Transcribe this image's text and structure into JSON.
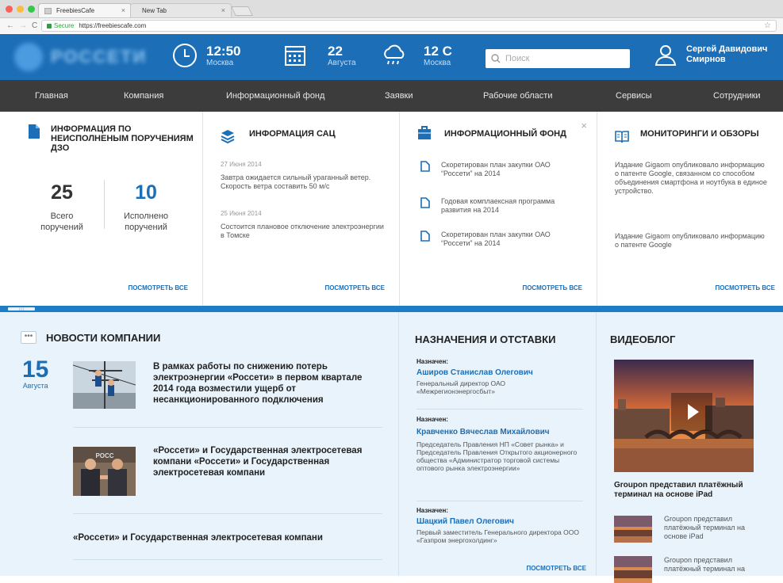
{
  "browser": {
    "tabs": [
      {
        "label": "FreebiesCafe"
      },
      {
        "label": "New Tab"
      }
    ],
    "secure_label": "Secure",
    "url": "https://freebiescafe.com"
  },
  "header": {
    "logo_text": "РОССЕТИ",
    "time": {
      "value": "12:50",
      "sub": "Москва"
    },
    "date": {
      "value": "22",
      "sub": "Августа"
    },
    "weather": {
      "value": "12 C",
      "sub": "Москва"
    },
    "search_placeholder": "Поиск",
    "user": {
      "first": "Сергей Давидович",
      "last": "Смирнов"
    }
  },
  "nav": [
    "Главная",
    "Компания",
    "Информационный фонд",
    "Заявки",
    "Рабочие области",
    "Сервисы",
    "Сотрудники"
  ],
  "widgets": {
    "orders": {
      "title": "Информация по неисполненым поручениям ДЗО",
      "total": "25",
      "total_label": "Всего поручений",
      "done": "10",
      "done_label": "Исполнено поручений",
      "more": "Посмотреть все"
    },
    "sac": {
      "title": "Информация САЦ",
      "items": [
        {
          "date": "27 Июня 2014",
          "text": "Завтра ожидается сильный ураганный ветер. Скорость ветра составить 50 м/с"
        },
        {
          "date": "25 Июня 2014",
          "text": "Состоится плановое отключение электроэнергии в Томске"
        }
      ],
      "more": "Посмотреть все"
    },
    "fund": {
      "title": "Информационный фонд",
      "items": [
        {
          "text": "Скоретирован план  закупки ОАО “Россети” на 2014"
        },
        {
          "text": "Годовая комплаексная программа развития на 2014"
        },
        {
          "text": "Скоретирован план  закупки ОАО “Россети” на 2014"
        }
      ],
      "more": "Посмотреть все"
    },
    "monitor": {
      "title": "Мониторинги и обзоры",
      "items": [
        {
          "text": "Издание Gigaom опубликовало информацию о патенте Google, связанном со способом объединения смартфона и ноутбука в единое устройство."
        },
        {
          "text": "Издание Gigaom опубликовало информацию о патенте Google"
        }
      ],
      "more": "Посмотреть все"
    }
  },
  "news": {
    "title": "Новости компании",
    "day": "15",
    "month": "Августа",
    "items": [
      {
        "headline": "В рамках работы по снижению потерь электроэнергии «Россети» в первом квартале 2014 года возместили ущерб от несанкционированного подключения"
      },
      {
        "headline": "«Россети» и Государственная электросетевая компани «Россети» и Государственная электросетевая компани"
      },
      {
        "headline": "«Россети» и Государственная электросетевая компани"
      }
    ]
  },
  "appointments": {
    "title": "Назначения и отставки",
    "items": [
      {
        "label": "Назначен:",
        "name": "Аширов Станислав Олегович",
        "role": "Генеральный директор ОАО «Межрегионэнергосбыт»"
      },
      {
        "label": "Назначен:",
        "name": "Кравченко Вячеслав Михайлович",
        "role": "Председатель Правления НП «Совет рынка» и Председатель Правления Открытого акционерного общества «Администратор торговой системы оптового рынка электроэнергии»"
      },
      {
        "label": "Назначен:",
        "name": "Шацкий Павел Олегович",
        "role": "Первый заместитель Генерального директора ООО «Газпром энергохолдинг»"
      }
    ],
    "more": "Посмотреть все"
  },
  "videoblog": {
    "title": "Видеоблог",
    "main_caption": "Groupon представил платёжный терминал на основе iPad",
    "items": [
      {
        "text": "Groupon представил платёжный терминал на основе iPad"
      },
      {
        "text": "Groupon представил платёжный терминал на"
      }
    ]
  },
  "colors": {
    "brand_blue": "#1c6eb6",
    "nav_dark": "#3c3c3c",
    "bottom_bg": "#e8f3fb"
  }
}
